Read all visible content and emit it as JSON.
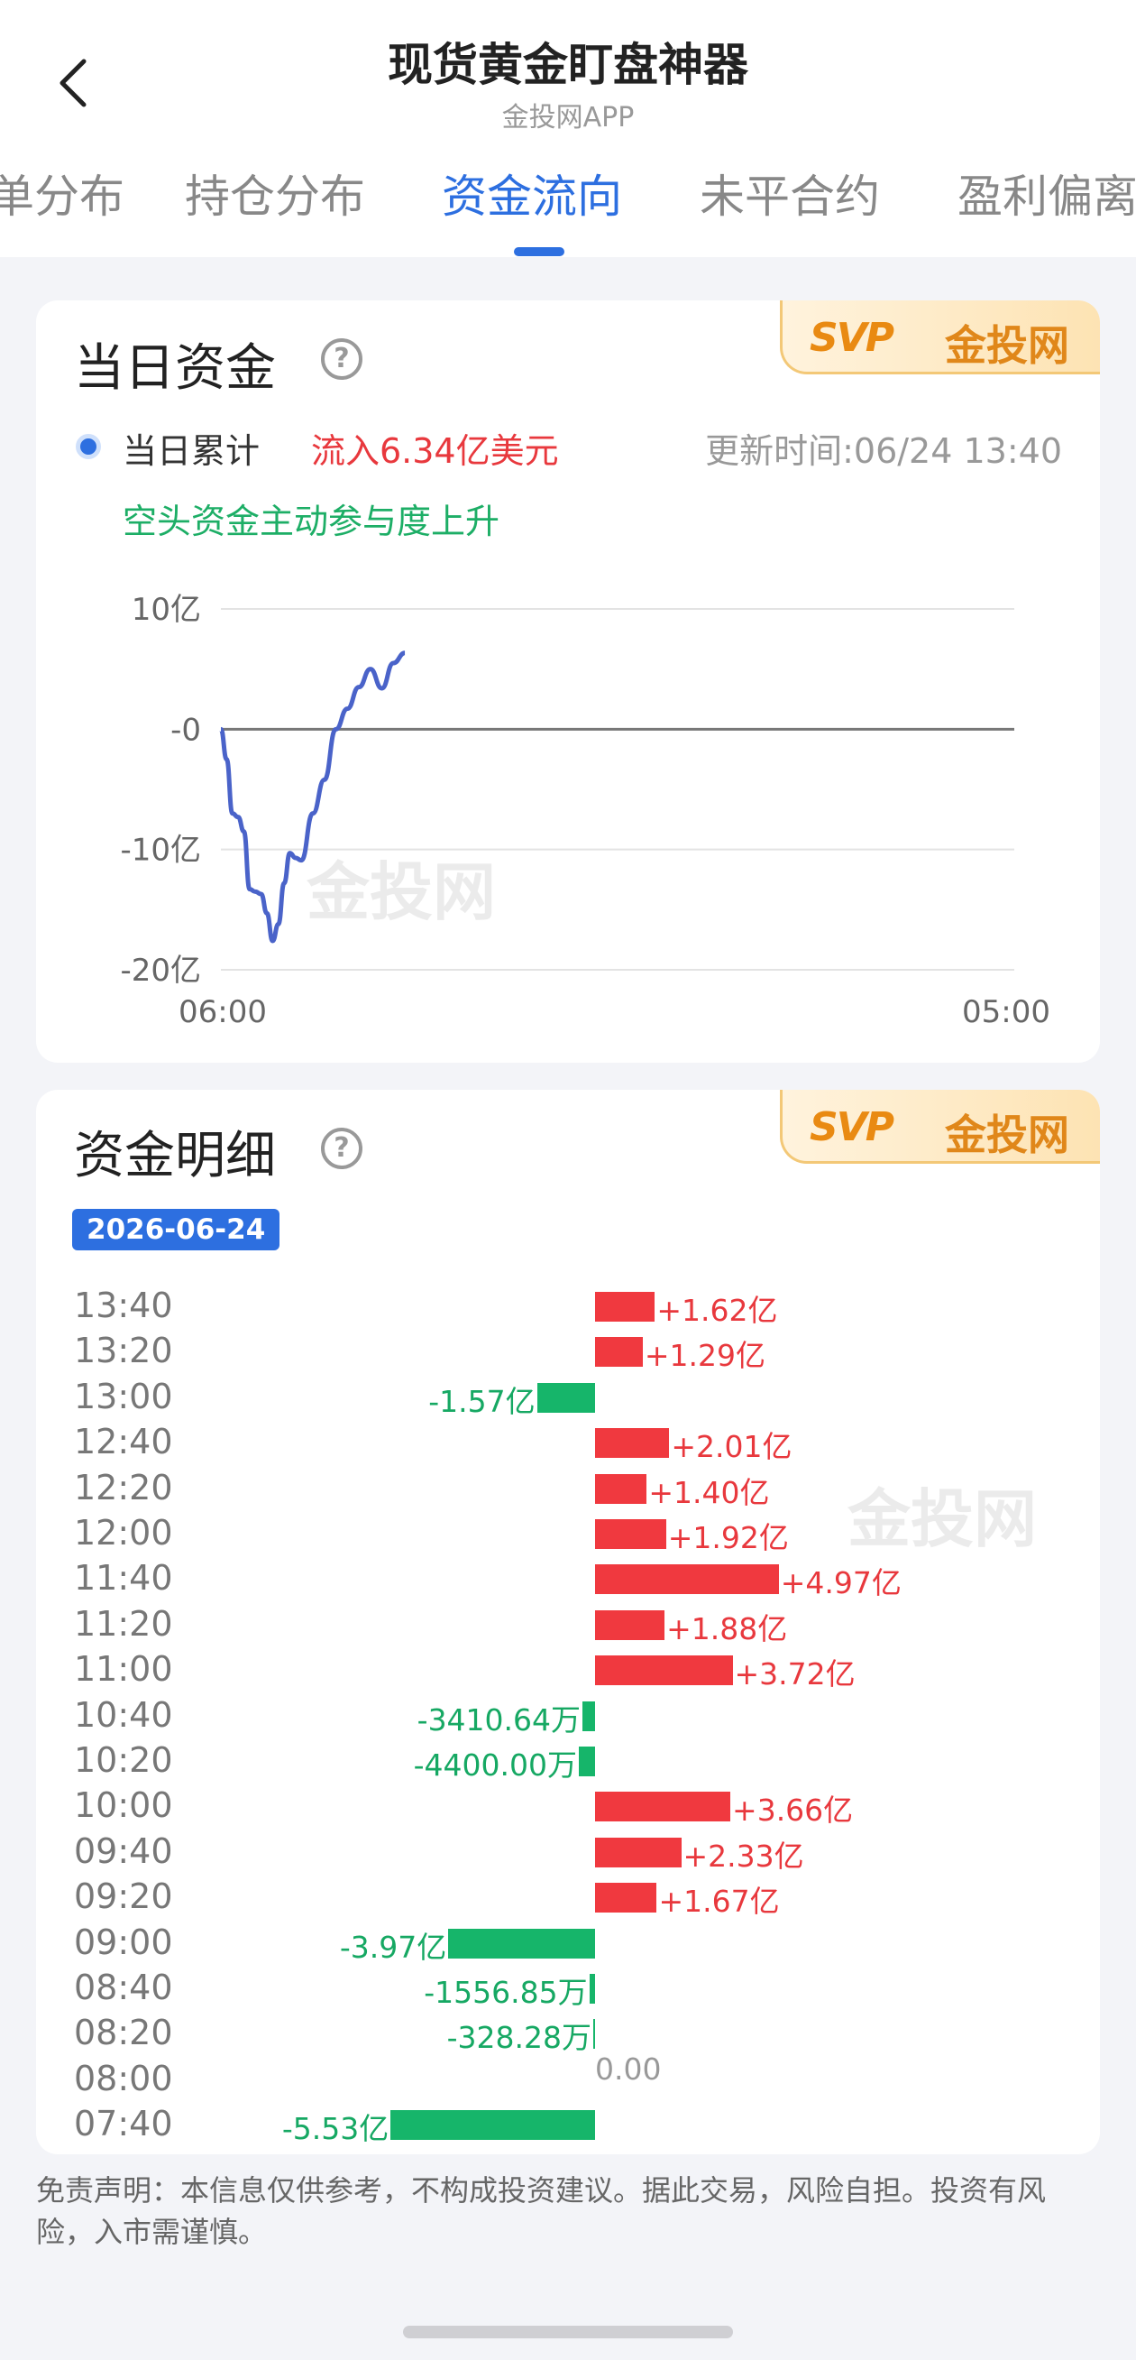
{
  "header": {
    "title": "现货黄金盯盘神器",
    "subtitle": "金投网APP"
  },
  "tabs": [
    {
      "label": "单分布",
      "active": false
    },
    {
      "label": "持仓分布",
      "active": false
    },
    {
      "label": "资金流向",
      "active": true
    },
    {
      "label": "未平合约",
      "active": false
    },
    {
      "label": "盈利偏离",
      "active": false
    }
  ],
  "brand": {
    "logo_mark": "SVP",
    "name": "金投网"
  },
  "daily": {
    "title": "当日资金",
    "help_icon": "question-circle-icon",
    "legend_label": "当日累计",
    "inflow_text": "流入6.34亿美元",
    "update_time": "更新时间:06/24 13:40",
    "hint": "空头资金主动参与度上升",
    "watermark": "金投网"
  },
  "chart_data": {
    "type": "line",
    "title": "",
    "xlabel": "",
    "ylabel": "",
    "y_tick_labels": [
      "10亿",
      "-0",
      "-10亿",
      "-20亿"
    ],
    "y_ticks": [
      10,
      0,
      -10,
      -20
    ],
    "ylim": [
      -20,
      10
    ],
    "x_tick_labels": [
      "06:00",
      "05:00"
    ],
    "grid": true,
    "series": [
      {
        "color": "#4a63c9",
        "x": [
          "06:00",
          "06:10",
          "06:20",
          "06:30",
          "06:40",
          "06:50",
          "07:00",
          "07:10",
          "07:20",
          "07:30",
          "07:40",
          "07:50",
          "08:00",
          "08:10",
          "08:20",
          "08:40",
          "09:00",
          "09:20",
          "09:40",
          "10:00",
          "10:20",
          "10:40",
          "11:00",
          "11:20",
          "11:40",
          "12:00",
          "12:20",
          "12:40",
          "13:00",
          "13:20",
          "13:40"
        ],
        "values": [
          0,
          -2.5,
          -7,
          -7.3,
          -8.5,
          -13.3,
          -13.5,
          -13.7,
          -15.3,
          -17.6,
          -16.2,
          -12.8,
          -10.3,
          -10.7,
          -10.9,
          -7,
          -4.2,
          0,
          1.7,
          3.5,
          5,
          3.4,
          5.5,
          6.34,
          6.34,
          6.34,
          6.34,
          6.34,
          6.34,
          6.34,
          6.34
        ]
      }
    ]
  },
  "detail": {
    "title": "资金明细",
    "help_icon": "question-circle-icon",
    "date": "2026-06-24",
    "watermark": "金投网",
    "zero_label": "0.00",
    "rows": [
      {
        "time": "13:40",
        "value": 1.62,
        "label": "+1.62亿"
      },
      {
        "time": "13:20",
        "value": 1.29,
        "label": "+1.29亿"
      },
      {
        "time": "13:00",
        "value": -1.57,
        "label": "-1.57亿"
      },
      {
        "time": "12:40",
        "value": 2.01,
        "label": "+2.01亿"
      },
      {
        "time": "12:20",
        "value": 1.4,
        "label": "+1.40亿"
      },
      {
        "time": "12:00",
        "value": 1.92,
        "label": "+1.92亿"
      },
      {
        "time": "11:40",
        "value": 4.97,
        "label": "+4.97亿"
      },
      {
        "time": "11:20",
        "value": 1.88,
        "label": "+1.88亿"
      },
      {
        "time": "11:00",
        "value": 3.72,
        "label": "+3.72亿"
      },
      {
        "time": "10:40",
        "value": -0.341064,
        "label": "-3410.64万"
      },
      {
        "time": "10:20",
        "value": -0.44,
        "label": "-4400.00万"
      },
      {
        "time": "10:00",
        "value": 3.66,
        "label": "+3.66亿"
      },
      {
        "time": "09:40",
        "value": 2.33,
        "label": "+2.33亿"
      },
      {
        "time": "09:20",
        "value": 1.67,
        "label": "+1.67亿"
      },
      {
        "time": "09:00",
        "value": -3.97,
        "label": "-3.97亿"
      },
      {
        "time": "08:40",
        "value": -0.155685,
        "label": "-1556.85万"
      },
      {
        "time": "08:20",
        "value": -0.032828,
        "label": "-328.28万"
      },
      {
        "time": "08:00",
        "value": 0,
        "label": "0.00"
      },
      {
        "time": "07:40",
        "value": -5.53,
        "label": "-5.53亿"
      }
    ]
  },
  "disclaimer": "免责声明：本信息仅供参考，不构成投资建议。据此交易，风险自担。投资有风险，入市需谨慎。",
  "colors": {
    "accent": "#2d6fe0",
    "positive": "#f0393f",
    "negative": "#16b56a",
    "line": "#4a63c9"
  }
}
